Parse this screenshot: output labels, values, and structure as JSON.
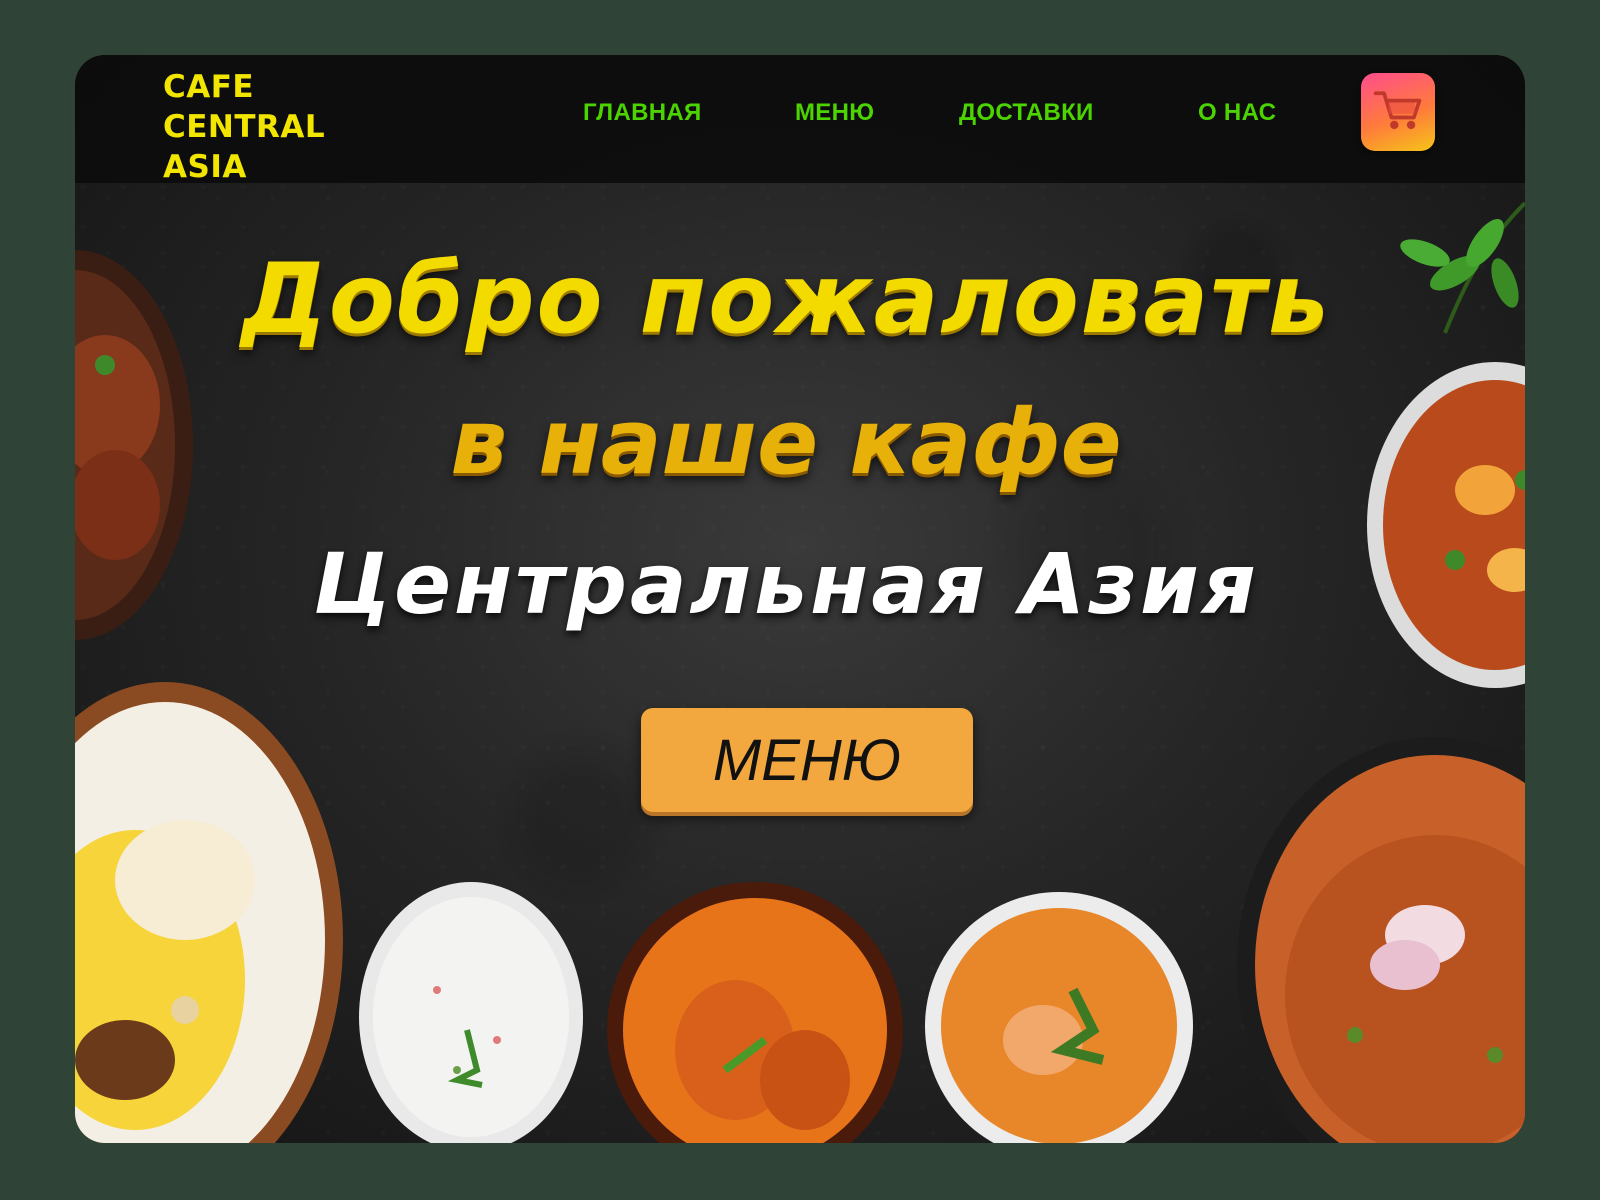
{
  "logo": {
    "line1": "CAFE",
    "line2": "CENTRAL",
    "line3": "ASIA"
  },
  "nav": {
    "items": [
      {
        "label": "ГЛАВНАЯ"
      },
      {
        "label": "МЕНЮ"
      },
      {
        "label": "ДОСТАВКИ"
      },
      {
        "label": "О НАС"
      }
    ],
    "cart_icon": "shopping-cart-icon"
  },
  "hero": {
    "title_line1": "Добро  пожаловать",
    "title_line2": "в наше кафе",
    "title_line3": "Центральная  Азия",
    "menu_button": "МЕНЮ"
  },
  "colors": {
    "page_background": "#2f4436",
    "logo": "#f2e600",
    "nav_link": "#4bd400",
    "title_yellow": "#f3db00",
    "title_gold": "#e8b10a",
    "button": "#f2a83e"
  }
}
